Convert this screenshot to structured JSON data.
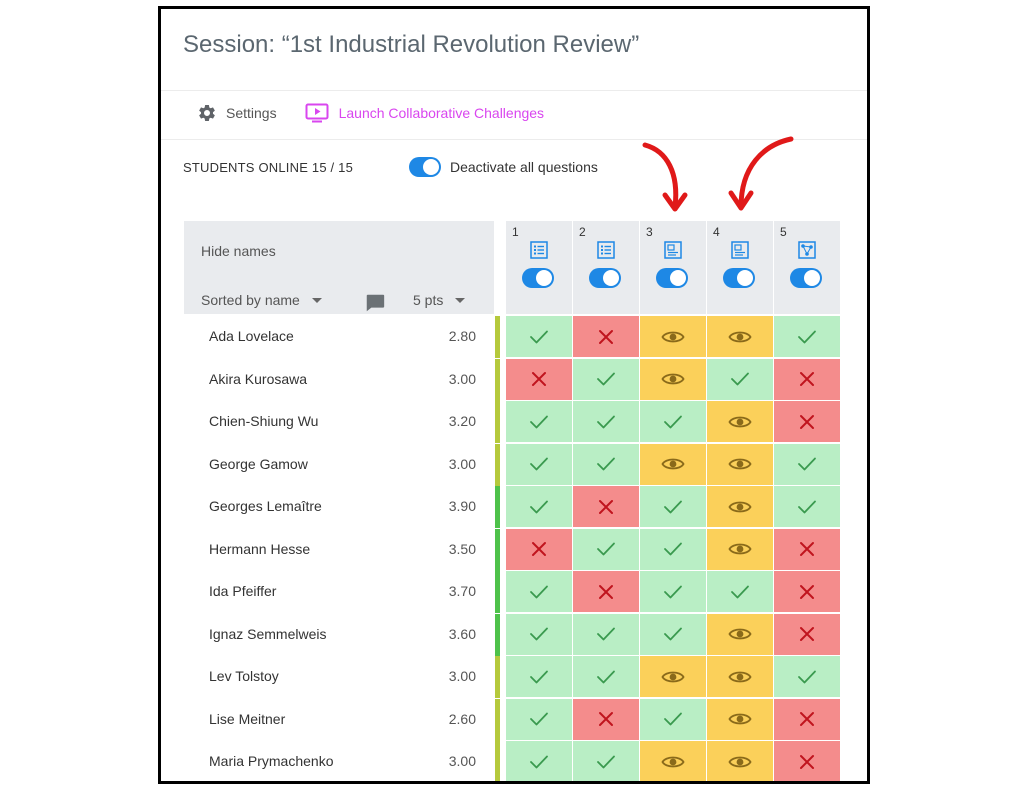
{
  "session": {
    "title": "Session: “1st Industrial Revolution Review”"
  },
  "toolbar": {
    "settings_label": "Settings",
    "launch_label": "Launch Collaborative Challenges"
  },
  "status": {
    "students_online": "STUDENTS ONLINE 15 / 15",
    "deactivate_label": "Deactivate all questions"
  },
  "table_header": {
    "hide_names": "Hide names",
    "sort_label": "Sorted by name",
    "points_label": "5 pts"
  },
  "questions": [
    {
      "number": "1",
      "icon": "list-icon"
    },
    {
      "number": "2",
      "icon": "list-icon"
    },
    {
      "number": "3",
      "icon": "image-text-icon"
    },
    {
      "number": "4",
      "icon": "image-text-icon"
    },
    {
      "number": "5",
      "icon": "network-icon"
    }
  ],
  "students": [
    {
      "name": "Ada Lovelace",
      "score": "2.80",
      "results": [
        "correct",
        "wrong",
        "seen",
        "seen",
        "correct"
      ]
    },
    {
      "name": "Akira Kurosawa",
      "score": "3.00",
      "results": [
        "wrong",
        "correct",
        "seen",
        "correct",
        "wrong"
      ]
    },
    {
      "name": "Chien-Shiung Wu",
      "score": "3.20",
      "results": [
        "correct",
        "correct",
        "correct",
        "seen",
        "wrong"
      ]
    },
    {
      "name": "George Gamow",
      "score": "3.00",
      "results": [
        "correct",
        "correct",
        "seen",
        "seen",
        "correct"
      ]
    },
    {
      "name": "Georges Lemaître",
      "score": "3.90",
      "results": [
        "correct",
        "wrong",
        "correct",
        "seen",
        "correct"
      ]
    },
    {
      "name": "Hermann Hesse",
      "score": "3.50",
      "results": [
        "wrong",
        "correct",
        "correct",
        "seen",
        "wrong"
      ]
    },
    {
      "name": "Ida Pfeiffer",
      "score": "3.70",
      "results": [
        "correct",
        "wrong",
        "correct",
        "correct",
        "wrong"
      ]
    },
    {
      "name": "Ignaz Semmelweis",
      "score": "3.60",
      "results": [
        "correct",
        "correct",
        "correct",
        "seen",
        "wrong"
      ]
    },
    {
      "name": "Lev Tolstoy",
      "score": "3.00",
      "results": [
        "correct",
        "correct",
        "seen",
        "seen",
        "correct"
      ]
    },
    {
      "name": "Lise Meitner",
      "score": "2.60",
      "results": [
        "correct",
        "wrong",
        "correct",
        "seen",
        "wrong"
      ]
    },
    {
      "name": "Maria Prymachenko",
      "score": "3.00",
      "results": [
        "correct",
        "correct",
        "seen",
        "seen",
        "wrong"
      ]
    }
  ],
  "colors": {
    "correct_bg": "#b9eec5",
    "wrong_bg": "#f48c8c",
    "seen_bg": "#fbd05a",
    "check": "#3a9a4f",
    "cross": "#c0141e",
    "eye": "#8a6a1a",
    "accent": "#1e88e5",
    "launch": "#d946ef",
    "arrow": "#e01919",
    "score_bar_low": "#b5c93c",
    "score_bar_high": "#4ec24a"
  }
}
